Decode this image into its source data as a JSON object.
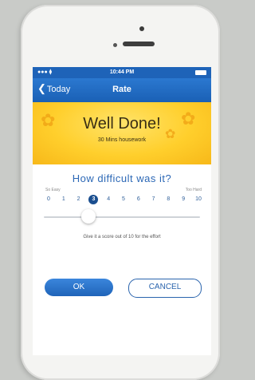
{
  "status_bar": {
    "time": "10:44 PM",
    "signal": "●●● ⧫"
  },
  "nav": {
    "back_label": "Today",
    "title": "Rate"
  },
  "hero": {
    "title": "Well Done!",
    "subtitle": "30 Mins housework"
  },
  "rating": {
    "question": "How difficult was it?",
    "min_label": "So Easy",
    "max_label": "Too Hard",
    "scale": [
      "0",
      "1",
      "2",
      "3",
      "4",
      "5",
      "6",
      "7",
      "8",
      "9",
      "10"
    ],
    "selected": 3,
    "hint": "Give it a score out of 10 for the effort"
  },
  "buttons": {
    "ok": "OK",
    "cancel": "CANCEL"
  },
  "colors": {
    "accent": "#1e63b8",
    "hero": "#ffcf2c",
    "selected": "#1a4e8f"
  }
}
